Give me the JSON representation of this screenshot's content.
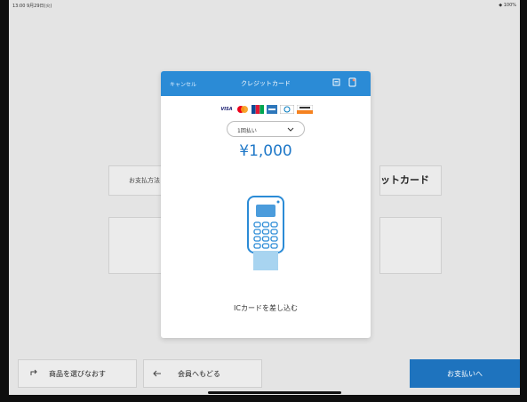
{
  "statusbar": {
    "time": "13:00 9月29日(火)",
    "right": "◆ 100%"
  },
  "background": {
    "method_label": "お支払方法",
    "method_value": "ットカード",
    "buttons": {
      "reselect": "商品を選びなおす",
      "back_member": "会員へもどる",
      "pay": "お支払いへ"
    }
  },
  "modal": {
    "cancel": "キャンセル",
    "title": "クレジットカード",
    "card_brands": [
      "VISA",
      "Mastercard",
      "JCB",
      "American Express",
      "Diners Club",
      "DISCOVER"
    ],
    "installment": {
      "selected": "1回払い"
    },
    "amount": "¥1,000",
    "instruction": "ICカードを差し込む"
  },
  "colors": {
    "accent": "#2b8bd6",
    "amount": "#1f78c8",
    "pay_button": "#1e73be"
  },
  "icons": [
    "arrow-icon",
    "back-arrow-icon",
    "receipt-icon",
    "tablet-icon",
    "chevron-down-icon",
    "card-terminal-icon"
  ]
}
